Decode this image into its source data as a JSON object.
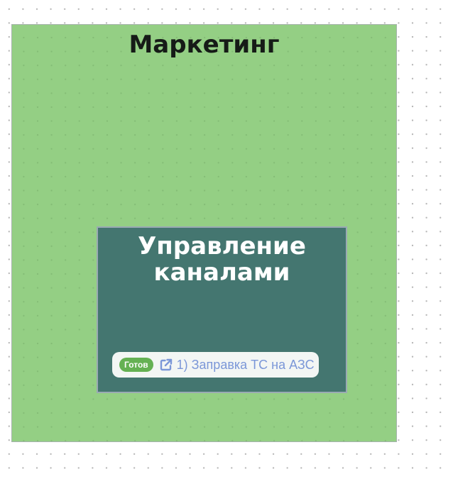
{
  "diagram": {
    "outer_group": {
      "title": "Маркетинг",
      "color": "#94cf84"
    },
    "inner_group": {
      "title_line1": "Управление",
      "title_line2": "каналами",
      "color": "#447670"
    },
    "task": {
      "status": "Готов",
      "status_color": "#65b153",
      "icon": "external-link-icon",
      "label": "1) Заправка ТС на АЗС",
      "link_color": "#7b97d8"
    }
  }
}
